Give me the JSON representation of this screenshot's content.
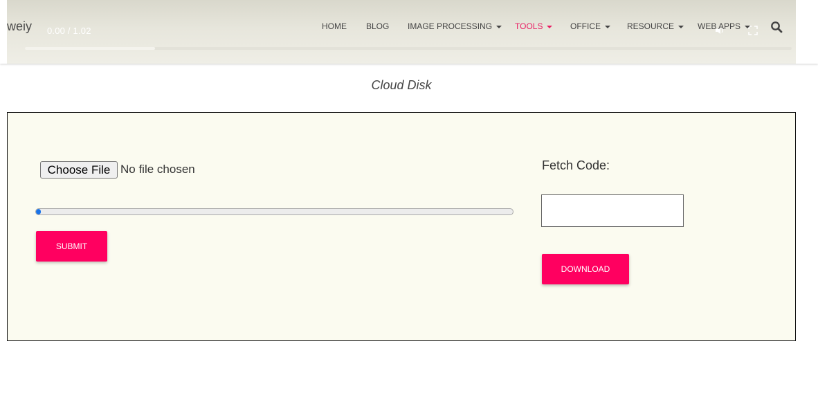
{
  "video": {
    "time": "0.00 / 1.02",
    "progress_fraction": 0.17,
    "volume_icon": "volume-icon",
    "fullscreen_icon": "fullscreen-icon"
  },
  "nav": {
    "brand": "weiy",
    "items": [
      {
        "label": "HOME",
        "dropdown": false,
        "active": false
      },
      {
        "label": "BLOG",
        "dropdown": false,
        "active": false
      },
      {
        "label": "IMAGE PROCESSING",
        "dropdown": true,
        "active": false
      },
      {
        "label": "TOOLS",
        "dropdown": true,
        "active": true
      },
      {
        "label": "OFFICE",
        "dropdown": true,
        "active": false
      },
      {
        "label": "RESOURCE",
        "dropdown": true,
        "active": false
      },
      {
        "label": "WEB APPS",
        "dropdown": true,
        "active": false
      }
    ],
    "search_icon": "search-icon",
    "active_color": "#e91e63"
  },
  "page": {
    "title": "Cloud Disk"
  },
  "upload": {
    "choose_file_label": "Choose File",
    "file_status": "No file chosen",
    "progress_fraction": 0.01,
    "submit_label": "SUBMIT"
  },
  "fetch": {
    "label": "Fetch Code:",
    "value": "",
    "download_label": "DOWNLOAD"
  },
  "colors": {
    "accent": "#ff0060",
    "panel_bg": "#fbfbf0"
  }
}
